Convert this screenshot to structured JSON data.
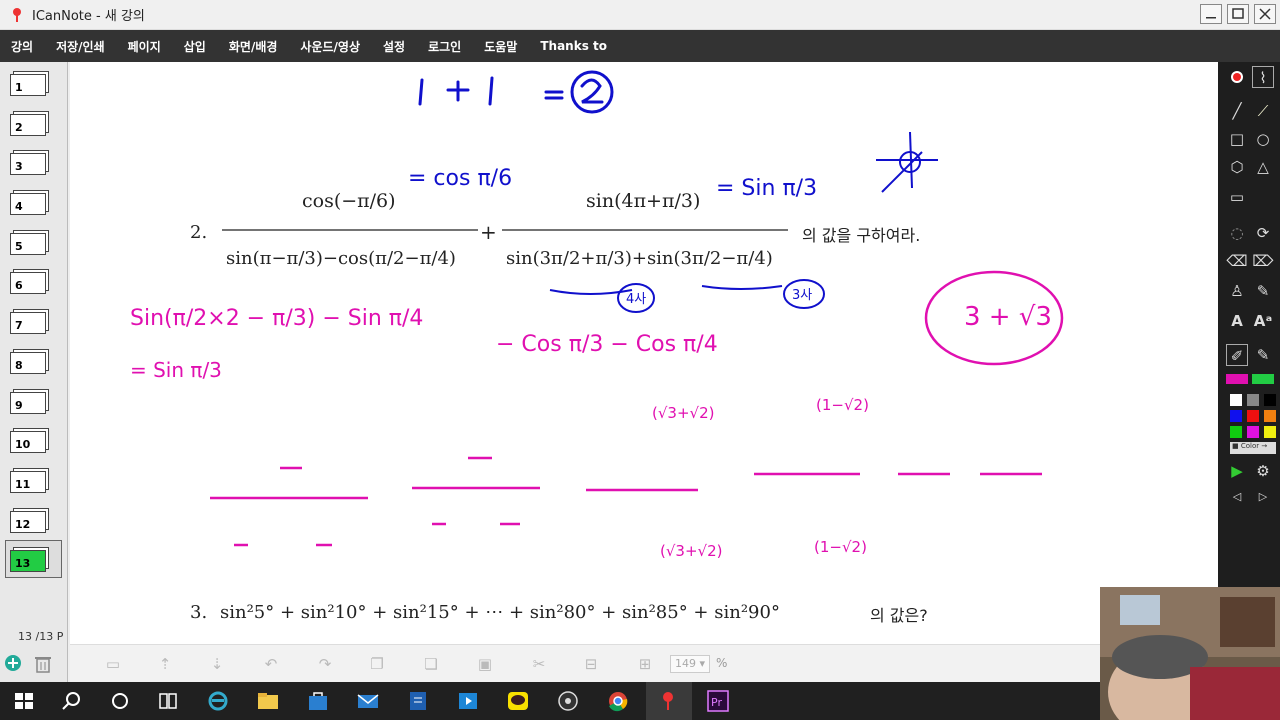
{
  "window": {
    "title": "ICanNote - 새 강의"
  },
  "menu": [
    "강의",
    "저장/인쇄",
    "페이지",
    "삽입",
    "화면/배경",
    "사운드/영상",
    "설정",
    "로그인",
    "도움말",
    "Thanks to"
  ],
  "pages": [
    "1",
    "2",
    "3",
    "4",
    "5",
    "6",
    "7",
    "8",
    "9",
    "10",
    "11",
    "12",
    "13"
  ],
  "active_page": "13",
  "page_count": "13 /13 P",
  "problem2": {
    "number": "2.",
    "suffix": "의 값을 구하여라.",
    "num1": "cos(−π/6)",
    "den1": "sin(π−π/3)−cos(π/2−π/4)",
    "num2": "sin(4π+π/3)",
    "den2": "sin(3π/2+π/3)+sin(3π/2−π/4)"
  },
  "problem3": {
    "number": "3.",
    "expr": "sin²5° + sin²10° + sin²15° + ⋯ + sin²80° + sin²85° + sin²90°",
    "suffix": "의 값은?"
  },
  "handwriting": {
    "top": "1 + 1 = 2",
    "ann_cos": "= cos π/6",
    "ann_sin": "= Sin π/3",
    "quad4": "4사",
    "quad3": "3사",
    "left_line": "Sin(π/2×2 − π/3) − Sin π/4",
    "left_line2": "= Sin π/3",
    "mid_line": "− Cos π/3   − Cos π/4",
    "answer": "3 + √3",
    "conj1": "(√3+√2)",
    "conj2": "(1−√2)"
  },
  "zoom": {
    "value": "149",
    "unit": "%"
  },
  "colors": {
    "accent_blue": "#1010cc",
    "accent_magenta": "#e010b0",
    "active_thumb": "#22cc44"
  }
}
